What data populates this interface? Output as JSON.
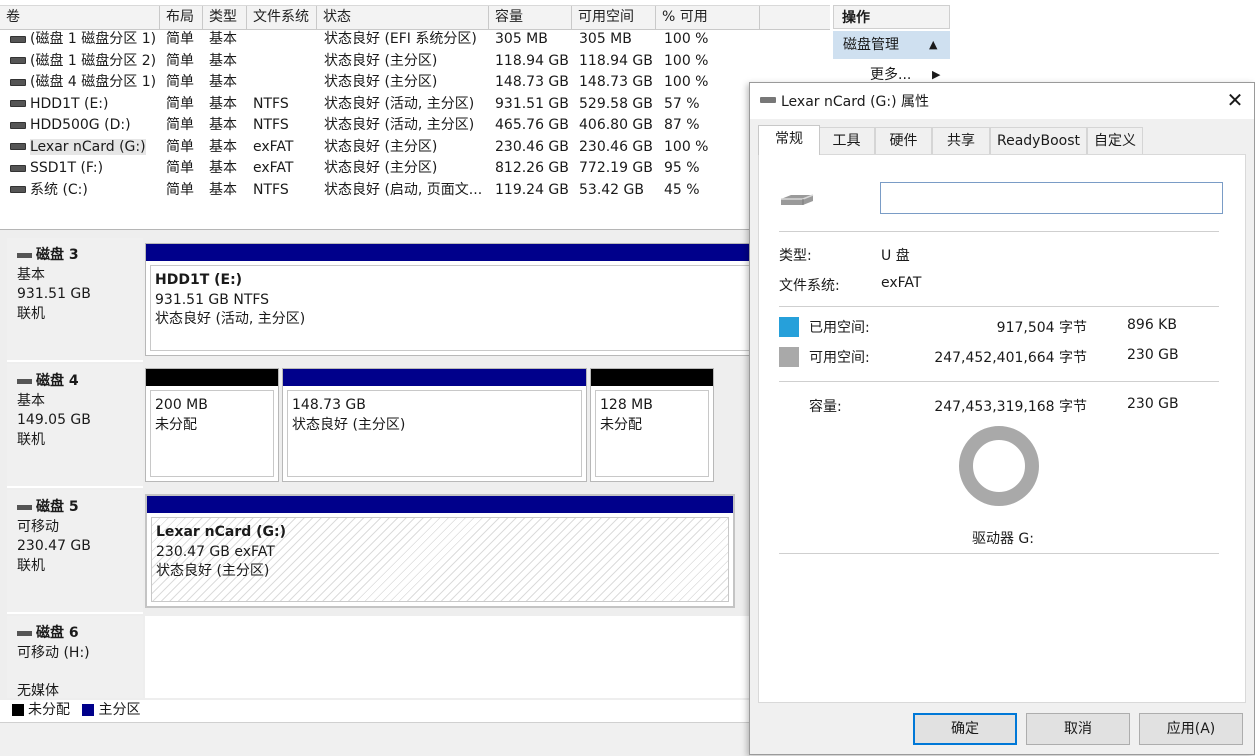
{
  "volume_list": {
    "columns": [
      "卷",
      "布局",
      "类型",
      "文件系统",
      "状态",
      "容量",
      "可用空间",
      "% 可用"
    ],
    "rows": [
      {
        "name": "(磁盘 1 磁盘分区 1)",
        "layout": "简单",
        "type": "基本",
        "fs": "",
        "status": "状态良好 (EFI 系统分区)",
        "capacity": "305 MB",
        "free": "305 MB",
        "pct": "100 %"
      },
      {
        "name": "(磁盘 1 磁盘分区 2)",
        "layout": "简单",
        "type": "基本",
        "fs": "",
        "status": "状态良好 (主分区)",
        "capacity": "118.94 GB",
        "free": "118.94 GB",
        "pct": "100 %"
      },
      {
        "name": "(磁盘 4 磁盘分区 1)",
        "layout": "简单",
        "type": "基本",
        "fs": "",
        "status": "状态良好 (主分区)",
        "capacity": "148.73 GB",
        "free": "148.73 GB",
        "pct": "100 %"
      },
      {
        "name": "HDD1T (E:)",
        "layout": "简单",
        "type": "基本",
        "fs": "NTFS",
        "status": "状态良好 (活动, 主分区)",
        "capacity": "931.51 GB",
        "free": "529.58 GB",
        "pct": "57 %"
      },
      {
        "name": "HDD500G (D:)",
        "layout": "简单",
        "type": "基本",
        "fs": "NTFS",
        "status": "状态良好 (活动, 主分区)",
        "capacity": "465.76 GB",
        "free": "406.80 GB",
        "pct": "87 %"
      },
      {
        "name": "Lexar nCard (G:)",
        "layout": "简单",
        "type": "基本",
        "fs": "exFAT",
        "status": "状态良好 (主分区)",
        "capacity": "230.46 GB",
        "free": "230.46 GB",
        "pct": "100 %"
      },
      {
        "name": "SSD1T (F:)",
        "layout": "简单",
        "type": "基本",
        "fs": "exFAT",
        "status": "状态良好 (主分区)",
        "capacity": "812.26 GB",
        "free": "772.19 GB",
        "pct": "95 %"
      },
      {
        "name": "系统 (C:)",
        "layout": "简单",
        "type": "基本",
        "fs": "NTFS",
        "status": "状态良好 (启动, 页面文...",
        "capacity": "119.24 GB",
        "free": "53.42 GB",
        "pct": "45 %"
      }
    ]
  },
  "disks": {
    "disk3": {
      "name": "磁盘 3",
      "kind": "基本",
      "size": "931.51 GB",
      "state": "联机",
      "partitions": [
        {
          "title": "HDD1T  (E:)",
          "line1": "931.51 GB NTFS",
          "line2": "状态良好 (活动, 主分区)"
        }
      ]
    },
    "disk4": {
      "name": "磁盘 4",
      "kind": "基本",
      "size": "149.05 GB",
      "state": "联机",
      "partitions": [
        {
          "line1": "200 MB",
          "line2": "未分配"
        },
        {
          "line1": "148.73 GB",
          "line2": "状态良好 (主分区)"
        },
        {
          "line1": "128 MB",
          "line2": "未分配"
        }
      ]
    },
    "disk5": {
      "name": "磁盘 5",
      "kind": "可移动",
      "size": "230.47 GB",
      "state": "联机",
      "partitions": [
        {
          "title": "Lexar nCard  (G:)",
          "line1": "230.47 GB exFAT",
          "line2": "状态良好 (主分区)"
        }
      ]
    },
    "disk6": {
      "name": "磁盘 6",
      "kind": "可移动 (H:)",
      "state": "无媒体"
    }
  },
  "legend": {
    "unallocated": "未分配",
    "primary": "主分区",
    "unallocated_color": "#000000",
    "primary_color": "#00008b"
  },
  "actions": {
    "header": "操作",
    "section": "磁盘管理",
    "more": "更多..."
  },
  "dialog": {
    "title": "Lexar nCard (G:) 属性",
    "tabs": [
      "常规",
      "工具",
      "硬件",
      "共享",
      "ReadyBoost",
      "自定义"
    ],
    "active_tab": "常规",
    "label_value": "",
    "type_label": "类型:",
    "type_value": "U 盘",
    "fs_label": "文件系统:",
    "fs_value": "exFAT",
    "used_label": "已用空间:",
    "used_bytes": "917,504 字节",
    "used_short": "896 KB",
    "free_label": "可用空间:",
    "free_bytes": "247,452,401,664 字节",
    "free_short": "230 GB",
    "cap_label": "容量:",
    "cap_bytes": "247,453,319,168 字节",
    "cap_short": "230 GB",
    "drive_label": "驱动器 G:",
    "used_fraction": 3.7e-06,
    "used_color": "#26a0da",
    "free_color": "#a9a9a9",
    "buttons": {
      "ok": "确定",
      "cancel": "取消",
      "apply": "应用(A)"
    }
  }
}
